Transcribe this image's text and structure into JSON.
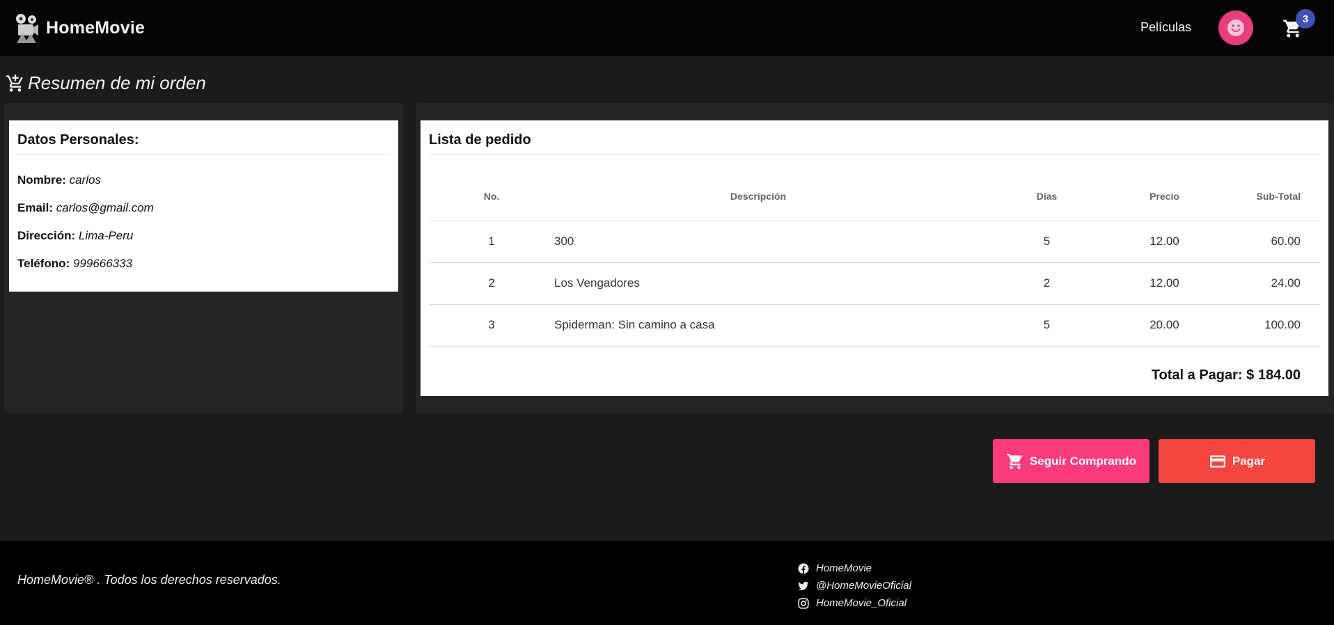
{
  "header": {
    "brand": "HomeMovie",
    "nav_link": "Películas",
    "cart_count": "3",
    "icons": [
      "movie-camera-logo",
      "smiley-avatar",
      "cart-icon"
    ]
  },
  "page": {
    "title": "Resumen de mi orden"
  },
  "personal": {
    "heading": "Datos Personales:",
    "fields": [
      {
        "label": "Nombre:",
        "value": "carlos"
      },
      {
        "label": "Email:",
        "value": "carlos@gmail.com"
      },
      {
        "label": "Dirección:",
        "value": "Lima-Peru"
      },
      {
        "label": "Teléfono:",
        "value": "999666333"
      }
    ]
  },
  "order": {
    "heading": "Lista de pedido",
    "columns": [
      "No.",
      "Descripción",
      "Días",
      "Precio",
      "Sub-Total"
    ],
    "rows": [
      {
        "no": "1",
        "desc": "300",
        "dias": "5",
        "precio": "12.00",
        "sub": "60.00"
      },
      {
        "no": "2",
        "desc": "Los Vengadores",
        "dias": "2",
        "precio": "12.00",
        "sub": "24.00"
      },
      {
        "no": "3",
        "desc": "Spiderman: Sin camino a casa",
        "dias": "5",
        "precio": "20.00",
        "sub": "100.00"
      }
    ],
    "total": "Total a Pagar: $ 184.00"
  },
  "actions": {
    "seguir": "Seguir Comprando",
    "pagar": "Pagar"
  },
  "footer": {
    "copyright": "HomeMovie® . Todos los derechos reservados.",
    "social": [
      {
        "icon": "facebook-icon",
        "text": "HomeMovie"
      },
      {
        "icon": "twitter-icon",
        "text": "@HomeMovieOficial"
      },
      {
        "icon": "instagram-icon",
        "text": "HomeMovie_Oficial"
      }
    ]
  },
  "colors": {
    "topbar": "#050505",
    "background": "#1b1b1b",
    "avatar": "#e83e7e",
    "badge": "#3f51b5",
    "seguir_button": "#fb3a7c",
    "pagar_button": "#f4463e"
  }
}
